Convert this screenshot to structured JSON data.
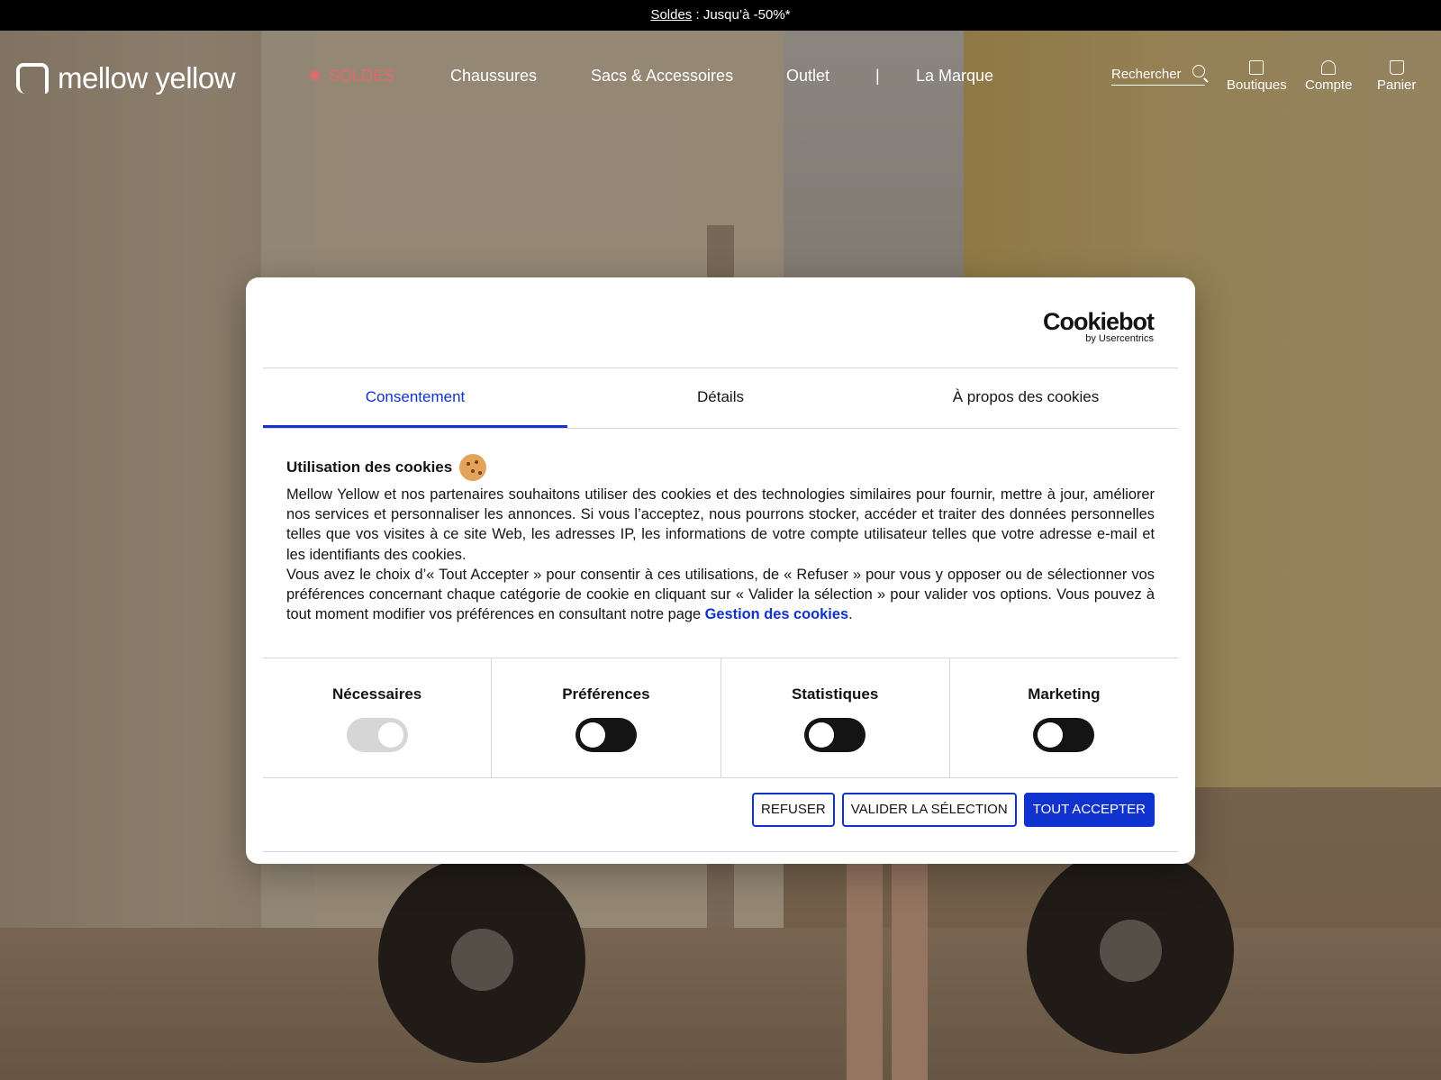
{
  "promo": {
    "link": "Soldes",
    "text": " : Jusqu’à -50%*"
  },
  "logo": {
    "text": "mellow yellow"
  },
  "nav": [
    {
      "label": "SOLDES",
      "icon": "gear-icon"
    },
    {
      "label": "Chaussures"
    },
    {
      "label": "Sacs & Accessoires"
    },
    {
      "label": "Outlet"
    },
    {
      "label": "|"
    },
    {
      "label": "La Marque"
    }
  ],
  "search": {
    "label": "Rechercher"
  },
  "tools": [
    {
      "label": "Boutiques",
      "icon": "store-icon"
    },
    {
      "label": "Compte",
      "icon": "user-icon"
    },
    {
      "label": "Panier",
      "icon": "bag-icon"
    }
  ],
  "cookiebot": {
    "brand": "Cookiebot",
    "by": "by Usercentrics"
  },
  "tabs": [
    {
      "label": "Consentement"
    },
    {
      "label": "Détails"
    },
    {
      "label": "À propos des cookies"
    }
  ],
  "consent": {
    "heading": "Utilisation des cookies",
    "para1": "Mellow Yellow et nos partenaires souhaitons utiliser des cookies et des technologies similaires pour fournir, mettre à jour, améliorer nos services et personnaliser les annonces. Si vous l’acceptez, nous pourrons stocker, accéder et traiter des données personnelles telles que vos visites à ce site Web, les adresses IP, les informations de votre compte utilisateur telles que votre adresse e-mail et les identifiants des cookies.",
    "para2": "Vous avez le choix d’« Tout Accepter » pour consentir à ces utilisations, de « Refuser » pour vous y opposer ou de sélectionner vos préférences concernant chaque catégorie de cookie en cliquant sur « Valider la sélection » pour valider vos options. Vous pouvez à tout moment modifier vos préférences en consultant notre page ",
    "link": "Gestion des cookies",
    "period": "."
  },
  "categories": [
    {
      "label": "Nécessaires",
      "enabled": true,
      "disabled": true
    },
    {
      "label": "Préférences",
      "enabled": false
    },
    {
      "label": "Statistiques",
      "enabled": false
    },
    {
      "label": "Marketing",
      "enabled": false
    }
  ],
  "buttons": {
    "refuse": "REFUSER",
    "select": "VALIDER LA SÉLECTION",
    "accept": "TOUT ACCEPTER"
  },
  "colors": {
    "accent": "#1032cf",
    "soldes": "#e4696b",
    "promo_bg": "#000000"
  }
}
